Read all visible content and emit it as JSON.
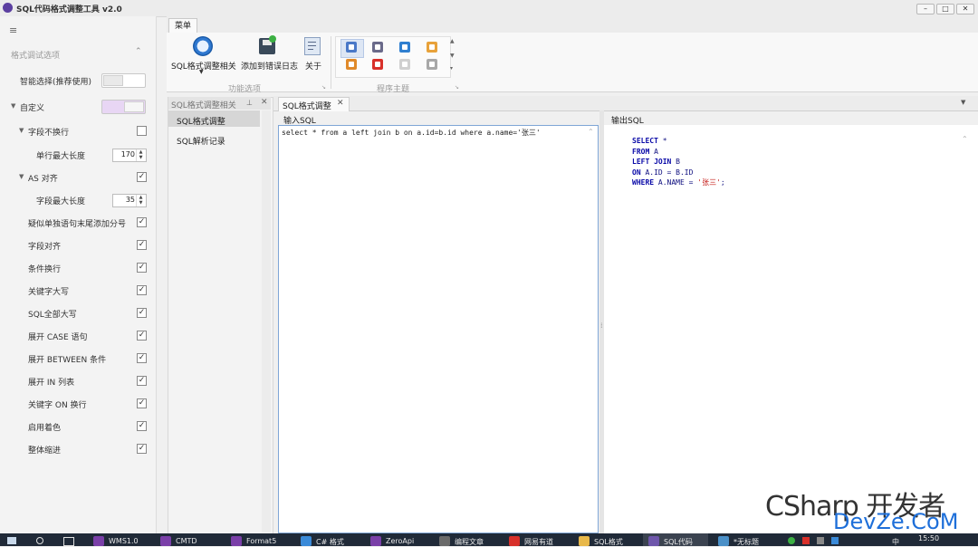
{
  "window": {
    "title": "SQL代码格式调整工具 v2.0",
    "controls": [
      "–",
      "□",
      "✕"
    ]
  },
  "left_panel": {
    "header": "格式调试选项",
    "options": [
      {
        "label": "智能选择(推荐使用)",
        "control": "toggle",
        "checked": false
      },
      {
        "label": "自定义",
        "control": "toggle",
        "checked": true
      },
      {
        "label": "字段不换行",
        "control": "checkbox",
        "checked": false
      },
      {
        "label": "单行最大长度",
        "control": "spinner",
        "value": "170"
      },
      {
        "label": "AS 对齐",
        "control": "checkbox",
        "checked": true
      },
      {
        "label": "字段最大长度",
        "control": "spinner",
        "value": "35"
      },
      {
        "label": "疑似单独语句末尾添加分号",
        "control": "checkbox",
        "checked": true
      },
      {
        "label": "字段对齐",
        "control": "checkbox",
        "checked": true
      },
      {
        "label": "条件换行",
        "control": "checkbox",
        "checked": true
      },
      {
        "label": "关键字大写",
        "control": "checkbox",
        "checked": true
      },
      {
        "label": "SQL全部大写",
        "control": "checkbox",
        "checked": true
      },
      {
        "label": "展开 CASE 语句",
        "control": "checkbox",
        "checked": true
      },
      {
        "label": "展开 BETWEEN 条件",
        "control": "checkbox",
        "checked": true
      },
      {
        "label": "展开 IN 列表",
        "control": "checkbox",
        "checked": true
      },
      {
        "label": "关键字 ON 换行",
        "control": "checkbox",
        "checked": true
      },
      {
        "label": "启用着色",
        "control": "checkbox",
        "checked": true
      },
      {
        "label": "整体缩进",
        "control": "checkbox",
        "checked": true
      }
    ],
    "check_glyph": "✓"
  },
  "ribbon": {
    "tab": "菜单",
    "buttons": [
      {
        "label": "SQL格式调整相关",
        "icon": "compass-icon"
      },
      {
        "label": "添加到错误日志",
        "icon": "save-icon"
      },
      {
        "label": "关于",
        "icon": "document-icon"
      }
    ],
    "groups": [
      "功能选项",
      "程序主题"
    ],
    "themes": [
      {
        "name": "theme-1",
        "color": "#4a78c8"
      },
      {
        "name": "theme-2",
        "color": "#6a6a8a"
      },
      {
        "name": "theme-3",
        "color": "#2f7fd0"
      },
      {
        "name": "theme-4",
        "color": "#e8a23a"
      },
      {
        "name": "theme-5",
        "color": "#e08a2a"
      },
      {
        "name": "theme-6",
        "color": "#d8302a"
      },
      {
        "name": "theme-7",
        "color": "#d0d0d0"
      },
      {
        "name": "theme-8",
        "color": "#a8a8a8"
      }
    ]
  },
  "nav_panel": {
    "title": "SQL格式调整相关",
    "items": [
      "SQL格式调整",
      "SQL解析记录"
    ]
  },
  "document": {
    "tab": "SQL格式调整",
    "input_label": "输入SQL",
    "output_label": "输出SQL",
    "input_sql": "select * from a left join b on a.id=b.id where a.name='张三'",
    "output_lines": [
      {
        "kw": "SELECT",
        "rest": " *"
      },
      {
        "kw": "FROM",
        "rest": " A"
      },
      {
        "kw": "LEFT JOIN",
        "rest": " B"
      },
      {
        "kw": "ON",
        "rest": " A.ID = B.ID"
      },
      {
        "kw": "WHERE",
        "rest": " A.NAME = ",
        "str": "'张三'",
        "end": ";"
      }
    ]
  },
  "taskbar": {
    "items": [
      {
        "label": "WMS1.0",
        "color": "#7a3fa8"
      },
      {
        "label": "CMTD",
        "color": "#7a3fa8"
      },
      {
        "label": "Format5",
        "color": "#7a3fa8"
      },
      {
        "label": "C# 格式",
        "color": "#3a8ad8"
      },
      {
        "label": "ZeroApi",
        "color": "#7a3fa8"
      },
      {
        "label": "编程文章",
        "color": "#6a6a6a"
      },
      {
        "label": "网易有道",
        "color": "#d8302a"
      },
      {
        "label": "SQL格式",
        "color": "#e8b84a"
      },
      {
        "label": "SQL代码",
        "color": "#5b3fa0"
      },
      {
        "label": "*无标题",
        "color": "#4a90c8"
      }
    ],
    "time": "15:50",
    "ime": "中"
  },
  "watermark": {
    "line1": "CSharp 开发者",
    "line2": "DevZe.CoM"
  }
}
